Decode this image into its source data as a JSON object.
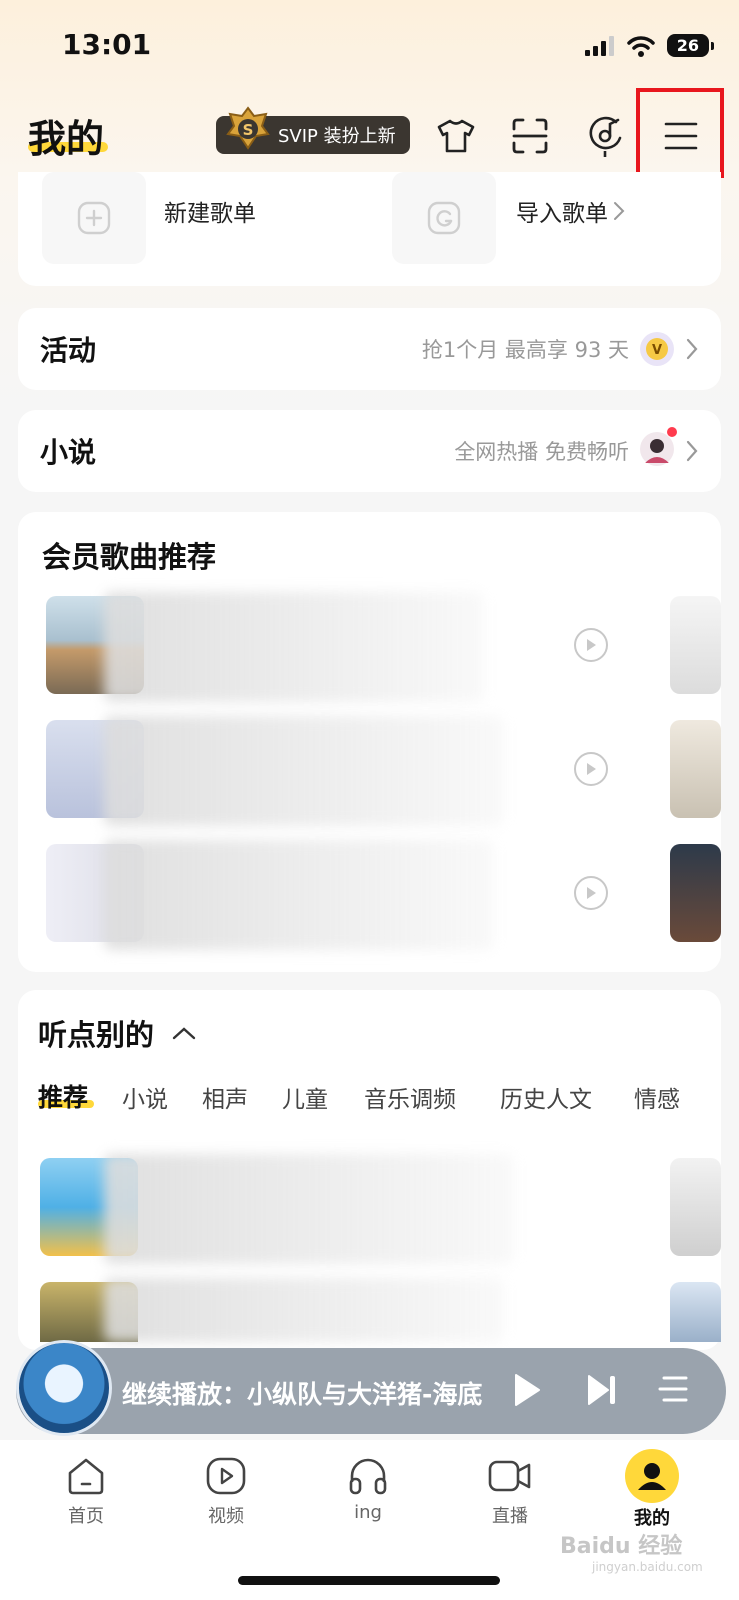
{
  "status": {
    "time": "13:01",
    "battery": "26"
  },
  "header": {
    "title": "我的",
    "svip_label": "SVIP 装扮上新"
  },
  "playlists": {
    "new_label": "新建歌单",
    "import_label": "导入歌单"
  },
  "activity": {
    "title": "活动",
    "subtitle": "抢1个月 最高享 93 天"
  },
  "novel": {
    "title": "小说",
    "subtitle": "全网热播 免费畅听"
  },
  "vip_songs": {
    "title": "会员歌曲推荐"
  },
  "listen_other": {
    "title": "听点别的",
    "tabs": [
      "推荐",
      "小说",
      "相声",
      "儿童",
      "音乐调频",
      "历史人文",
      "情感"
    ]
  },
  "mini_player": {
    "text": "继续播放：小纵队与大洋猪-海底"
  },
  "nav": {
    "items": [
      "首页",
      "视频",
      "ing",
      "直播",
      "我的"
    ]
  },
  "watermark": {
    "main": "Baidu 经验",
    "sub": "jingyan.baidu.com"
  },
  "colors": {
    "accent_yellow": "#ffd83a",
    "highlight_red": "#e8161d",
    "player_bg": "#9aa3ad"
  }
}
